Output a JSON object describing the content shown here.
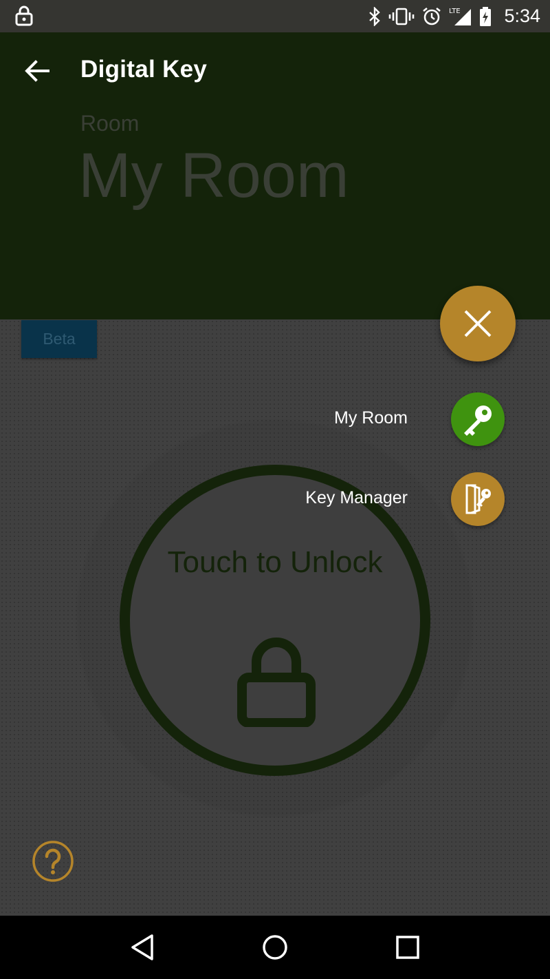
{
  "status_bar": {
    "network": "LTE",
    "time": "5:34",
    "icons": [
      "lock-icon",
      "bluetooth-icon",
      "vibrate-icon",
      "alarm-icon",
      "lte-signal-icon",
      "battery-charging-icon"
    ]
  },
  "header": {
    "title": "Digital Key",
    "room_label": "Room",
    "room_name": "My Room"
  },
  "content": {
    "beta_label": "Beta",
    "unlock_text": "Touch to Unlock"
  },
  "fab_menu": {
    "items": [
      {
        "label": "My Room",
        "icon": "key-icon",
        "color": "#3f930f"
      },
      {
        "label": "Key Manager",
        "icon": "key-manager-icon",
        "color": "#b5852a"
      }
    ],
    "close_icon": "close-icon"
  },
  "colors": {
    "header_bg": "#14230a",
    "accent": "#b5852a",
    "green_accent": "#3f930f",
    "beta_bg": "#09334a"
  }
}
